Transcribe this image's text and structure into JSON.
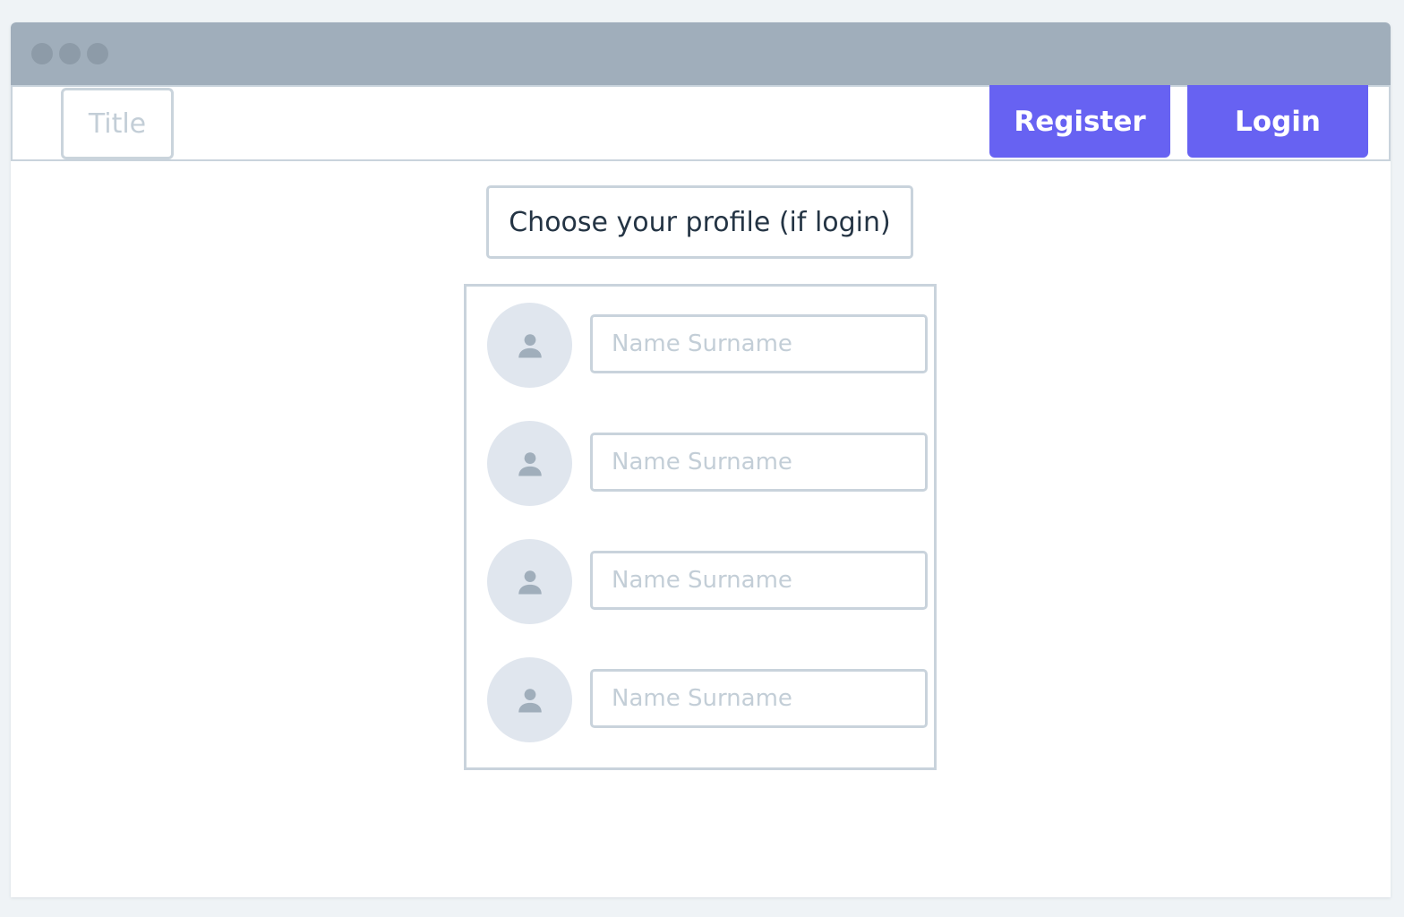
{
  "navbar": {
    "title": "Title",
    "register_label": "Register",
    "login_label": "Login"
  },
  "main": {
    "heading": "Choose your profile (if login)",
    "profiles": [
      {
        "placeholder": "Name Surname",
        "icon": "user-icon"
      },
      {
        "placeholder": "Name Surname",
        "icon": "user-icon"
      },
      {
        "placeholder": "Name Surname",
        "icon": "user-icon"
      },
      {
        "placeholder": "Name Surname",
        "icon": "user-icon"
      }
    ]
  },
  "colors": {
    "accent": "#6762f2",
    "titlebar": "#a0aebb",
    "border": "#c9d3dc",
    "avatar_bg": "#e0e6ee",
    "icon": "#a0aebb"
  }
}
